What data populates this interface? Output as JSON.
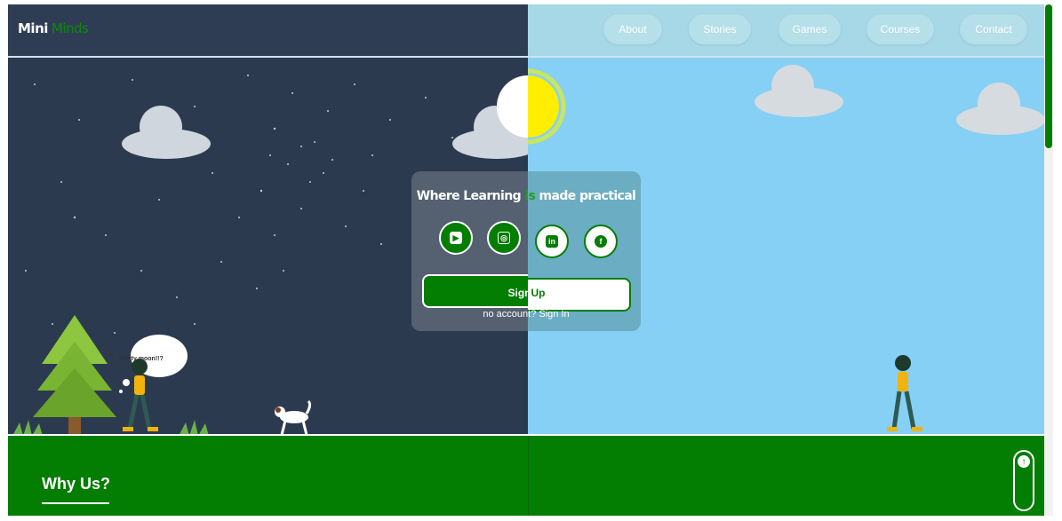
{
  "brand": {
    "name_main": "Mini",
    "name_accent": "Minds"
  },
  "nav": {
    "items": [
      "About",
      "Stories",
      "Games",
      "Courses",
      "Contact"
    ]
  },
  "hero": {
    "headline_part1": "Where Learning ",
    "headline_accent": "is",
    "headline_part2": " made practical",
    "thought_bubble": "Pretty moon!!?",
    "signup_left": "Sign",
    "signup_right": " Up",
    "no_account": "no account",
    "no_account_tail": "? ",
    "sign_in": "Sign In"
  },
  "social": [
    {
      "name": "youtube-icon"
    },
    {
      "name": "instagram-icon"
    },
    {
      "name": "linkedin-icon"
    },
    {
      "name": "facebook-icon"
    }
  ],
  "section": {
    "why_us": "Why Us?"
  },
  "colors": {
    "green": "#047d03",
    "night": "#2c3a50",
    "day": "#86d0f5"
  }
}
